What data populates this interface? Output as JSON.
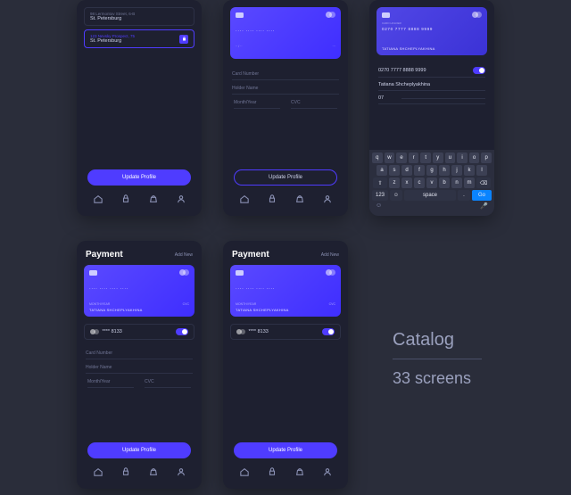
{
  "buttons": {
    "update_profile": "Update Profile"
  },
  "nav": [
    "home",
    "lock",
    "bag",
    "user"
  ],
  "addresses": {
    "row1": {
      "line1": "98 Lermontov Street, 6-B",
      "line2": "St. Petersburg"
    },
    "row2": {
      "line1": "123 Nevsky Prospect, 75",
      "line2": "St. Petersburg"
    }
  },
  "card": {
    "number_masked_dots": "····  ····  ····  ····",
    "exp_dots": "·· / ··",
    "cvc_dots": "···",
    "label_exp": "MONTH/YEAR",
    "label_cvc": "CVC",
    "holder_label": "CARD HOLDER",
    "holder_name": "TATIANA SHCHEPLYAKHINA",
    "number_live": "0270 7777 8888 9999",
    "exp_partial": "07",
    "cvc_partial": ""
  },
  "form": {
    "card_number": "Card Number",
    "holder": "Holder Name",
    "month_year": "Month/Year",
    "cvc": "CVC"
  },
  "saved_card": {
    "last4": "**** 8133",
    "toggle_on": true
  },
  "live_fields": {
    "number": "0270 7777 8888 9999",
    "holder": "Tatiana Shcheplyakhina",
    "month": "07",
    "year": ""
  },
  "payment": {
    "title": "Payment",
    "add_new": "Add New"
  },
  "keyboard": {
    "rowA": [
      "q",
      "w",
      "e",
      "r",
      "t",
      "y",
      "u",
      "i",
      "o",
      "p"
    ],
    "rowB": [
      "a",
      "s",
      "d",
      "f",
      "g",
      "h",
      "j",
      "k",
      "l"
    ],
    "rowC_shift": "⇧",
    "rowC": [
      "z",
      "x",
      "c",
      "v",
      "b",
      "n",
      "m"
    ],
    "rowC_del": "⌫",
    "rowD": {
      "num": "123",
      "emoji": "☺",
      "space": "space",
      "dot": ".",
      "go": "Go"
    }
  },
  "side": {
    "catalog": "Catalog",
    "screens": "33 screens"
  }
}
